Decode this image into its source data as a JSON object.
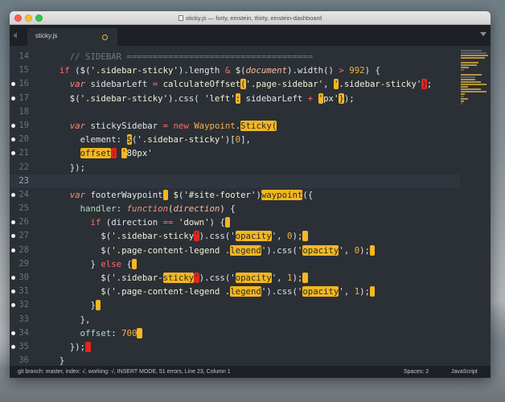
{
  "window": {
    "title": "sticky.js — forty, einstein, thirty, einstein-dashboard"
  },
  "tabs": [
    {
      "label": "sticky.js",
      "modified": true
    }
  ],
  "editor": {
    "current_line": 23,
    "lines": [
      {
        "n": "14",
        "mark": false,
        "tokens": [
          [
            "    ",
            ""
          ],
          [
            "// SIDEBAR ====================================",
            "cm"
          ]
        ]
      },
      {
        "n": "15",
        "mark": false,
        "tokens": [
          [
            "  ",
            ""
          ],
          [
            "if",
            "kw"
          ],
          [
            " (",
            "op"
          ],
          [
            "$",
            "fn"
          ],
          [
            "(",
            "op"
          ],
          [
            "'.sidebar-sticky'",
            "st"
          ],
          [
            ").length ",
            "op"
          ],
          [
            "&",
            "kw"
          ],
          [
            " ",
            ""
          ],
          [
            "$",
            "fn"
          ],
          [
            "(",
            "op"
          ],
          [
            "document",
            "it"
          ],
          [
            ").width() ",
            "op"
          ],
          [
            ">",
            "kw"
          ],
          [
            " ",
            ""
          ],
          [
            "992",
            "nm"
          ],
          [
            ") {",
            "op"
          ]
        ]
      },
      {
        "n": "16",
        "mark": true,
        "tokens": [
          [
            "    ",
            ""
          ],
          [
            "var",
            "kt"
          ],
          [
            " sidebarLeft ",
            "op"
          ],
          [
            "=",
            "kw"
          ],
          [
            " calculateOffset",
            "fn"
          ],
          [
            "(",
            "hl-y"
          ],
          [
            "'.page-sidebar'",
            "st"
          ],
          [
            ", ",
            "op"
          ],
          [
            "'",
            "hl-y"
          ],
          [
            ".sidebar-sticky'",
            "st"
          ],
          [
            ")",
            "hl-r"
          ],
          [
            ";",
            "op"
          ]
        ]
      },
      {
        "n": "17",
        "mark": true,
        "tokens": [
          [
            "    ",
            ""
          ],
          [
            "$",
            "fn"
          ],
          [
            "(",
            "op"
          ],
          [
            "'.sidebar-sticky'",
            "st"
          ],
          [
            ").css( ",
            "op"
          ],
          [
            "'left'",
            "st"
          ],
          [
            ":",
            "hl-y"
          ],
          [
            " sidebarLeft ",
            "op"
          ],
          [
            "+",
            "kw"
          ],
          [
            " ",
            ""
          ],
          [
            "'",
            "hl-y"
          ],
          [
            "px'",
            "st"
          ],
          [
            "}",
            "hl-y"
          ],
          [
            ");",
            "op"
          ]
        ]
      },
      {
        "n": "18",
        "mark": false,
        "tokens": []
      },
      {
        "n": "19",
        "mark": true,
        "tokens": [
          [
            "    ",
            ""
          ],
          [
            "var",
            "kt"
          ],
          [
            " stickySidebar ",
            "op"
          ],
          [
            "=",
            "kw"
          ],
          [
            " ",
            ""
          ],
          [
            "new",
            "kw"
          ],
          [
            " Waypoint",
            "cl"
          ],
          [
            ".",
            "op"
          ],
          [
            "Sticky(",
            "hl-y"
          ]
        ]
      },
      {
        "n": "20",
        "mark": true,
        "tokens": [
          [
            "      ",
            ""
          ],
          [
            "element",
            "op"
          ],
          [
            ": ",
            "op"
          ],
          [
            "$",
            "hl-y"
          ],
          [
            "(",
            "op"
          ],
          [
            "'.sidebar-sticky'",
            "st"
          ],
          [
            ")[",
            "op"
          ],
          [
            "0",
            "nm"
          ],
          [
            "],",
            "op"
          ]
        ]
      },
      {
        "n": "21",
        "mark": true,
        "tokens": [
          [
            "      ",
            ""
          ],
          [
            "offset",
            "hl-y"
          ],
          [
            ":",
            "hl-r"
          ],
          [
            " ",
            ""
          ],
          [
            "'",
            "hl-y"
          ],
          [
            "80px'",
            "st"
          ]
        ]
      },
      {
        "n": "22",
        "mark": false,
        "tokens": [
          [
            "    ",
            ""
          ],
          [
            "});",
            "op"
          ]
        ]
      },
      {
        "n": "23",
        "mark": false,
        "tokens": []
      },
      {
        "n": "24",
        "mark": true,
        "tokens": [
          [
            "    ",
            ""
          ],
          [
            "var",
            "kt"
          ],
          [
            " footerWaypoint",
            "op"
          ],
          [
            " ",
            "hl-y"
          ],
          [
            " ",
            ""
          ],
          [
            "$",
            "fn"
          ],
          [
            "(",
            "op"
          ],
          [
            "'#site-footer'",
            "st"
          ],
          [
            ")",
            "op"
          ],
          [
            "waypoint",
            "hl-y"
          ],
          [
            "({",
            "op"
          ]
        ]
      },
      {
        "n": "25",
        "mark": false,
        "tokens": [
          [
            "      ",
            ""
          ],
          [
            "handler",
            "pr"
          ],
          [
            ": ",
            "op"
          ],
          [
            "function",
            "kt"
          ],
          [
            "(",
            "op"
          ],
          [
            "direction",
            "it"
          ],
          [
            ") {",
            "op"
          ]
        ]
      },
      {
        "n": "26",
        "mark": true,
        "tokens": [
          [
            "        ",
            ""
          ],
          [
            "if",
            "kw"
          ],
          [
            " (direction ",
            "op"
          ],
          [
            "==",
            "kw"
          ],
          [
            " ",
            ""
          ],
          [
            "'down'",
            "st"
          ],
          [
            ") {",
            "op"
          ],
          [
            " ",
            "hl-y"
          ]
        ]
      },
      {
        "n": "27",
        "mark": true,
        "tokens": [
          [
            "          ",
            ""
          ],
          [
            "$",
            "fn"
          ],
          [
            "(",
            "op"
          ],
          [
            "'.sidebar-sticky",
            "st"
          ],
          [
            "'",
            "hl-r"
          ],
          [
            ").css(",
            "op"
          ],
          [
            "'",
            "op"
          ],
          [
            "opacity",
            "hl-y"
          ],
          [
            "'",
            "op"
          ],
          [
            ", ",
            "op"
          ],
          [
            "0",
            "nm"
          ],
          [
            ");",
            "op"
          ],
          [
            " ",
            "hl-y"
          ]
        ]
      },
      {
        "n": "28",
        "mark": true,
        "tokens": [
          [
            "          ",
            ""
          ],
          [
            "$",
            "fn"
          ],
          [
            "(",
            "op"
          ],
          [
            "'.page-content-legend .",
            "st"
          ],
          [
            "legend",
            "hl-y"
          ],
          [
            "'",
            "st"
          ],
          [
            ").css(",
            "op"
          ],
          [
            "'",
            "op"
          ],
          [
            "opacity",
            "hl-y"
          ],
          [
            "'",
            "op"
          ],
          [
            ", ",
            "op"
          ],
          [
            "0",
            "nm"
          ],
          [
            ");",
            "op"
          ],
          [
            " ",
            "hl-y"
          ]
        ]
      },
      {
        "n": "29",
        "mark": false,
        "tokens": [
          [
            "        ",
            ""
          ],
          [
            "} ",
            "op"
          ],
          [
            "else",
            "kw"
          ],
          [
            " {",
            "op"
          ],
          [
            " ",
            "hl-y"
          ]
        ]
      },
      {
        "n": "30",
        "mark": true,
        "tokens": [
          [
            "          ",
            ""
          ],
          [
            "$",
            "fn"
          ],
          [
            "(",
            "op"
          ],
          [
            "'.sidebar-",
            "st"
          ],
          [
            "sticky",
            "hl-y"
          ],
          [
            "'",
            "hl-r"
          ],
          [
            ").css(",
            "op"
          ],
          [
            "'",
            "op"
          ],
          [
            "opacity",
            "hl-y"
          ],
          [
            "'",
            "op"
          ],
          [
            ", ",
            "op"
          ],
          [
            "1",
            "nm"
          ],
          [
            ");",
            "op"
          ],
          [
            " ",
            "hl-y"
          ]
        ]
      },
      {
        "n": "31",
        "mark": true,
        "tokens": [
          [
            "          ",
            ""
          ],
          [
            "$",
            "fn"
          ],
          [
            "(",
            "op"
          ],
          [
            "'.page-content-legend .",
            "st"
          ],
          [
            "legend",
            "hl-y"
          ],
          [
            "'",
            "st"
          ],
          [
            ").css(",
            "op"
          ],
          [
            "'",
            "op"
          ],
          [
            "opacity",
            "hl-y"
          ],
          [
            "'",
            "op"
          ],
          [
            ", ",
            "op"
          ],
          [
            "1",
            "nm"
          ],
          [
            ");",
            "op"
          ],
          [
            " ",
            "hl-y"
          ]
        ]
      },
      {
        "n": "32",
        "mark": true,
        "tokens": [
          [
            "        ",
            ""
          ],
          [
            "}",
            "op"
          ],
          [
            " ",
            "hl-y"
          ]
        ]
      },
      {
        "n": "33",
        "mark": false,
        "tokens": [
          [
            "      ",
            ""
          ],
          [
            "},",
            "op"
          ]
        ]
      },
      {
        "n": "34",
        "mark": true,
        "tokens": [
          [
            "      ",
            ""
          ],
          [
            "offset",
            "pr"
          ],
          [
            ": ",
            "op"
          ],
          [
            "700",
            "nm"
          ],
          [
            " ",
            "hl-y"
          ]
        ]
      },
      {
        "n": "35",
        "mark": true,
        "tokens": [
          [
            "    ",
            ""
          ],
          [
            "});",
            "op"
          ],
          [
            " ",
            "hl-r"
          ]
        ]
      },
      {
        "n": "36",
        "mark": false,
        "tokens": [
          [
            "  ",
            ""
          ],
          [
            "}",
            "op"
          ]
        ]
      }
    ]
  },
  "status": {
    "left": "git branch: master, index: √, working: √, INSERT MODE, 51 errors, Line 23, Column 1",
    "spaces": "Spaces: 2",
    "syntax": "JavaScript"
  },
  "colors": {
    "error_highlight": "#e3251d",
    "warning_highlight": "#f4b721",
    "editor_bg": "#2b3036"
  }
}
